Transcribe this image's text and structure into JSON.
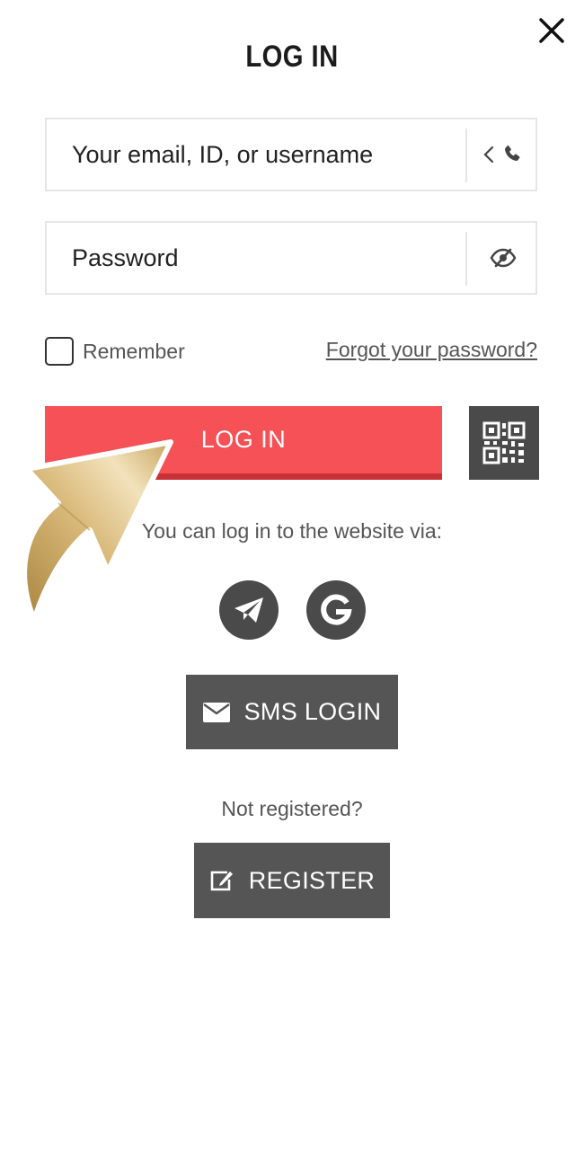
{
  "header": {
    "title": "LOG IN"
  },
  "form": {
    "email_placeholder": "Your email, ID, or username",
    "password_placeholder": "Password",
    "remember_label": "Remember",
    "forgot_link": "Forgot your password?",
    "login_button": "LOG IN"
  },
  "social": {
    "via_text": "You can log in to the website via:",
    "providers": [
      "telegram-icon",
      "google-icon"
    ]
  },
  "sms": {
    "label": "SMS LOGIN"
  },
  "register": {
    "prompt": "Not registered?",
    "label": "REGISTER"
  },
  "colors": {
    "accent": "#f55156",
    "dark_button": "#555555",
    "icon_circle": "#4a4a4a"
  }
}
